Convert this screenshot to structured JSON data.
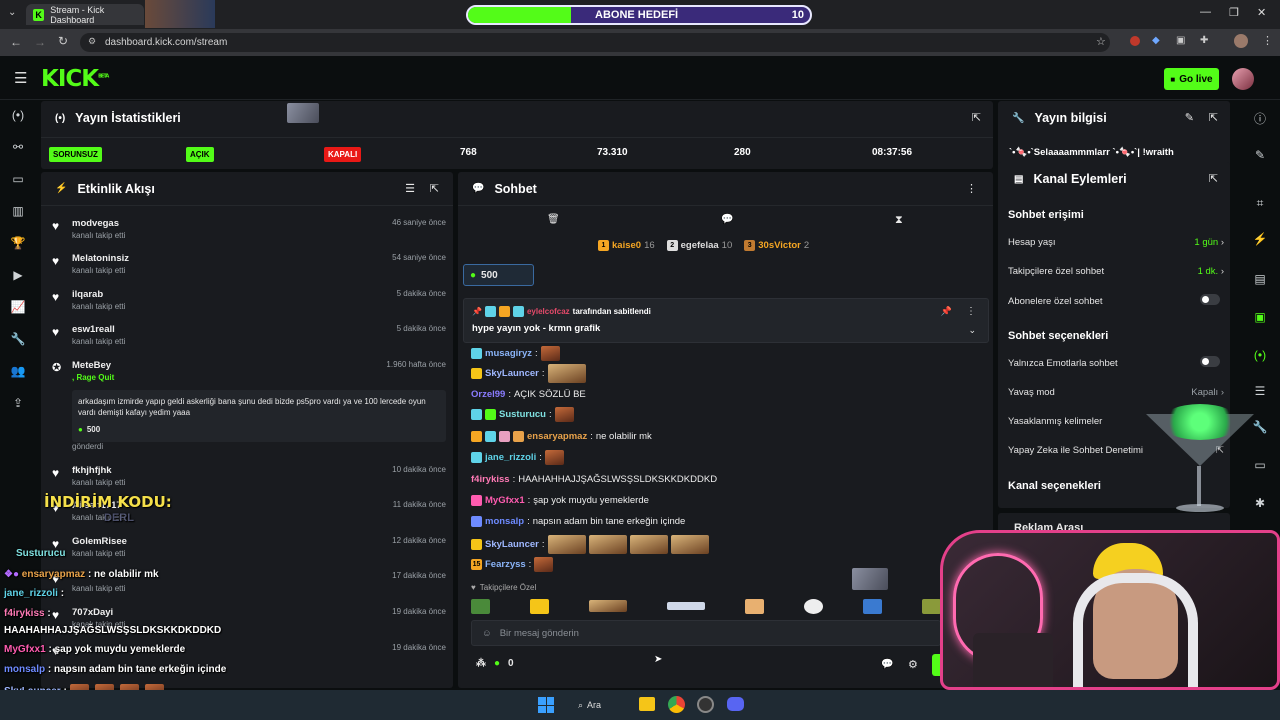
{
  "browser": {
    "tab_title": "Stream - Kick Dashboard",
    "url": "dashboard.kick.com/stream",
    "sub_goal_label": "ABONE HEDEFİ",
    "sub_goal_value": "10",
    "sub_goal_progress": 0.3
  },
  "header": {
    "logo": "KICK",
    "logo_beta": "BETA",
    "go_live": "Go live"
  },
  "stats": {
    "title": "Yayın İstatistikleri",
    "cells": [
      {
        "pill": "SORUNSUZ",
        "color": "#53fc18"
      },
      {
        "pill": "AÇIK",
        "color": "#53fc18"
      },
      {
        "pill": "KAPALI",
        "color": "#e91916"
      },
      {
        "value": "768"
      },
      {
        "value": "73.310"
      },
      {
        "value": "280"
      },
      {
        "value": "08:37:56"
      }
    ]
  },
  "stream_info": {
    "title": "Yayın bilgisi",
    "text": "`•🍬•`Selaaaammmlarr `•🍬•`| !wraith"
  },
  "activity": {
    "title": "Etkinlik Akışı",
    "items": [
      {
        "name": "modvegas",
        "sub": "kanalı takip etti",
        "time": "46 saniye önce"
      },
      {
        "name": "Melatoninsiz",
        "sub": "kanalı takip etti",
        "time": "54 saniye önce"
      },
      {
        "name": "ilqarab",
        "sub": "kanalı takip etti",
        "time": "5 dakika önce"
      },
      {
        "name": "esw1reall",
        "sub": "kanalı takip etti",
        "time": "5 dakika önce"
      }
    ],
    "redeem": {
      "name": "MeteBey",
      "reward": ", Rage Quit",
      "time": "1.960 hafta önce",
      "message": "arkadaşım izmirde yapıp geldi askerliği bana şunu dedi bizde ps5pro vardı ya ve 100 lercede oyun vardı demişti kafayı yedim yaaa",
      "points": "500",
      "footer": "gönderdi"
    },
    "items2": [
      {
        "name": "fkhjhfjhk",
        "sub": "kanalı takip etti",
        "time": "10 dakika önce"
      },
      {
        "name": "Ailsan1717",
        "sub": "kanalı takip etti",
        "time": "11 dakika önce"
      },
      {
        "name": "GolemRisee",
        "sub": "kanalı takip etti",
        "time": "12 dakika önce"
      },
      {
        "name": "",
        "sub": "kanalı takip etti",
        "time": "17 dakika önce"
      },
      {
        "name": "707xDayi",
        "sub": "kanalı takip etti",
        "time": "19 dakika önce"
      },
      {
        "name": "",
        "sub": "",
        "time": "19 dakika önce"
      }
    ]
  },
  "chat": {
    "title": "Sohbet",
    "leaders": [
      {
        "name": "kaise0",
        "count": "16",
        "color": "#f5a623"
      },
      {
        "name": "egefelaa",
        "count": "10",
        "color": "#dddddd"
      },
      {
        "name": "30sVictor",
        "count": "2",
        "color": "#f5a623"
      }
    ],
    "points_box": "500",
    "pinned_by": "eylelcofcaz",
    "pinned_suffix": "tarafından sabitlendi",
    "pinned_msg": "hype yayın yok - krmn grafik",
    "messages": [
      {
        "user": "musagiryz",
        "color": "#8ab4f8",
        "text": ""
      },
      {
        "user": "SkyLauncer",
        "color": "#9fb8ff",
        "text": ""
      },
      {
        "user": "Orzel99",
        "color": "#8a7cff",
        "text": "AÇIK SÖZLÜ BE"
      },
      {
        "user": "Susturucu",
        "color": "#7fe0e0",
        "text": ""
      },
      {
        "user": "ensaryapmaz",
        "color": "#e8a24a",
        "text": "ne olabilir mk"
      },
      {
        "user": "jane_rizzoli",
        "color": "#5fd3e8",
        "text": ""
      },
      {
        "user": "f4irykiss",
        "color": "#ff7ab6",
        "text": "HAAHAHHAJJŞAĞSLWSŞSLDKSKKDKDDKD"
      },
      {
        "user": "MyGfxx1",
        "color": "#ff5cb0",
        "text": "şap yok muydu yemeklerde"
      },
      {
        "user": "monsalp",
        "color": "#6e8bff",
        "text": "napsın adam bin tane erkeğin içinde"
      },
      {
        "user": "SkyLauncer",
        "color": "#9fb8ff",
        "text": ""
      },
      {
        "user": "Fearzyss",
        "color": "#8ab4f8",
        "text": ""
      }
    ],
    "emote_tab": "Takipçilere Özel",
    "input_placeholder": "Bir mesaj gönderin",
    "points_count": "0"
  },
  "channel_actions": {
    "title": "Kanal Eylemleri",
    "access_title": "Sohbet erişimi",
    "account_age_label": "Hesap yaşı",
    "account_age_value": "1 gün",
    "followers_label": "Takipçilere özel sohbet",
    "followers_value": "1 dk.",
    "subs_label": "Abonelere özel sohbet",
    "options_title": "Sohbet seçenekleri",
    "emote_only_label": "Yalnızca Emotlarla sohbet",
    "slow_label": "Yavaş mod",
    "slow_value": "Kapalı",
    "banned_label": "Yasaklanmış kelimeler",
    "ai_label": "Yapay Zeka ile Sohbet Denetimi",
    "channel_options": "Kanal seçenekleri",
    "ad_break": "Reklam Arası"
  },
  "overlay": {
    "discount": "İNDİRİM KODU:",
    "discount_code": "DERL",
    "chat": [
      {
        "user": "Susturucu",
        "color": "#7fe0e0",
        "text": ""
      },
      {
        "user": "ensaryapmaz",
        "color": "#e8a24a",
        "text": ": ne olabilir mk"
      },
      {
        "user": "jane_rizzoli",
        "color": "#5fd3e8",
        "text": ":"
      },
      {
        "user": "f4irykiss",
        "color": "#ff7ab6",
        "text": ":"
      },
      {
        "user": "",
        "color": "#ffffff",
        "text": "HAAHAHHAJJŞAĞSLWSŞSLDKSKKDKDDKD"
      },
      {
        "user": "MyGfxx1",
        "color": "#ff5cb0",
        "text": ": şap yok muydu yemeklerde"
      },
      {
        "user": "monsalp",
        "color": "#6e8bff",
        "text": ": napsın adam bin tane erkeğin içinde"
      },
      {
        "user": "SkyLauncer",
        "color": "#9fb8ff",
        "text": ":"
      }
    ]
  },
  "taskbar": {
    "search": "Ara"
  }
}
